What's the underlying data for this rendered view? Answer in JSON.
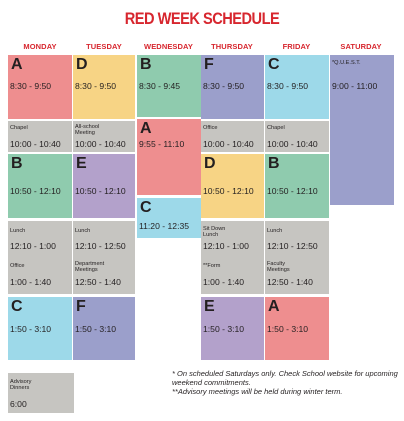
{
  "title": "RED WEEK SCHEDULE",
  "days": [
    "MONDAY",
    "TUESDAY",
    "WEDNESDAY",
    "THURSDAY",
    "FRIDAY",
    "SATURDAY"
  ],
  "colors": {
    "title": "#d7262e",
    "pink": "#ee8e8f",
    "yellow": "#f7d485",
    "green": "#8fcbae",
    "purple": "#b3a1cb",
    "blue": "#9dd9e9",
    "lavender": "#9b9fcb",
    "gray": "#c6c5c1"
  },
  "blocks": {
    "mon_a": {
      "letter": "A",
      "time": "8:30 - 9:50"
    },
    "tue_d": {
      "letter": "D",
      "time": "8:30 - 9:50"
    },
    "wed_b": {
      "letter": "B",
      "time": "8:30 - 9:45"
    },
    "thu_f": {
      "letter": "F",
      "time": "8:30 - 9:50"
    },
    "fri_c": {
      "letter": "C",
      "time": "8:30 - 9:50"
    },
    "sat_quest": {
      "label": "*Q.U.E.S.T.",
      "time": "9:00 - 11:00"
    },
    "mon_chapel": {
      "label": "Chapel",
      "time": "10:00 - 10:40"
    },
    "tue_meeting": {
      "label": "All-school\nMeeting",
      "time": "10:00 - 10:40"
    },
    "wed_a": {
      "letter": "A",
      "time": "9:55 - 11:10"
    },
    "thu_office": {
      "label": "Office",
      "time": "10:00 - 10:40"
    },
    "fri_chapel": {
      "label": "Chapel",
      "time": "10:00 - 10:40"
    },
    "mon_b": {
      "letter": "B",
      "time": "10:50 - 12:10"
    },
    "tue_e": {
      "letter": "E",
      "time": "10:50 - 12:10"
    },
    "wed_c": {
      "letter": "C",
      "time": "11:20 - 12:35"
    },
    "thu_d": {
      "letter": "D",
      "time": "10:50 - 12:10"
    },
    "fri_b": {
      "letter": "B",
      "time": "10:50 - 12:10"
    },
    "mon_lunch": {
      "label": "Lunch",
      "time": "12:10 - 1:00",
      "label2": "Office",
      "time2": "1:00 - 1:40"
    },
    "tue_lunch": {
      "label": "Lunch",
      "time": "12:10 - 12:50",
      "label2": "Department\nMeetings",
      "time2": "12:50 - 1:40"
    },
    "thu_lunch": {
      "label": "Sit Down\nLunch",
      "time": "12:10 - 1:00",
      "label2": "**Form",
      "time2": "1:00 - 1:40"
    },
    "fri_lunch": {
      "label": "Lunch",
      "time": "12:10 - 12:50",
      "label2": "Faculty\nMeetings",
      "time2": "12:50 - 1:40"
    },
    "mon_c": {
      "letter": "C",
      "time": "1:50 - 3:10"
    },
    "tue_f": {
      "letter": "F",
      "time": "1:50 - 3:10"
    },
    "thu_e": {
      "letter": "E",
      "time": "1:50 - 3:10"
    },
    "fri_a": {
      "letter": "A",
      "time": "1:50 - 3:10"
    },
    "advisory": {
      "label": "Advisory\nDinners",
      "time": "6:00"
    }
  },
  "notes": {
    "line1": "* On scheduled Saturdays only. Check School website for upcoming weekend commitments.",
    "line2": "**Advisory meetings will be held during winter term."
  }
}
